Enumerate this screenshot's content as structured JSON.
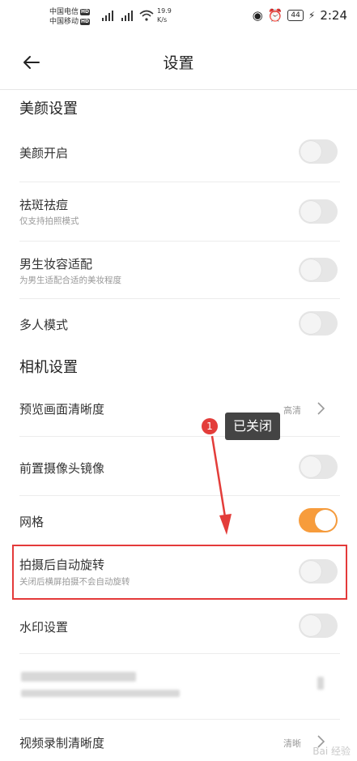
{
  "status_bar": {
    "carrier1": "中国电信",
    "carrier2": "中国移动",
    "hd_badge": "HD",
    "net_speed": "19.9",
    "net_unit": "K/s",
    "battery": "44",
    "time": "2:24"
  },
  "header": {
    "title": "设置"
  },
  "sections": {
    "beauty": "美颜设置",
    "camera": "相机设置"
  },
  "rows": {
    "beauty_on": {
      "title": "美颜开启",
      "enabled": false
    },
    "spot": {
      "title": "祛斑祛痘",
      "subtitle": "仅支持拍照模式",
      "enabled": false
    },
    "male_makeup": {
      "title": "男生妆容适配",
      "subtitle": "为男生适配合适的美妆程度",
      "enabled": false
    },
    "multi_person": {
      "title": "多人模式",
      "enabled": false
    },
    "preview_clarity": {
      "title": "预览画面清晰度",
      "value": "高清"
    },
    "front_mirror": {
      "title": "前置摄像头镜像",
      "enabled": false
    },
    "grid": {
      "title": "网格",
      "enabled": true
    },
    "auto_rotate": {
      "title": "拍摄后自动旋转",
      "subtitle": "关闭后横屏拍摄不会自动旋转",
      "enabled": false
    },
    "watermark": {
      "title": "水印设置",
      "enabled": false
    },
    "video_clarity": {
      "title": "视频录制清晰度",
      "value": "清晰"
    }
  },
  "annotation": {
    "number": "1",
    "label": "已关闭"
  },
  "watermark_text": "Bai 经验",
  "colors": {
    "toggle_on": "#f79c3c",
    "highlight_box": "#e43a3a",
    "callout_badge": "#e33d3a"
  }
}
